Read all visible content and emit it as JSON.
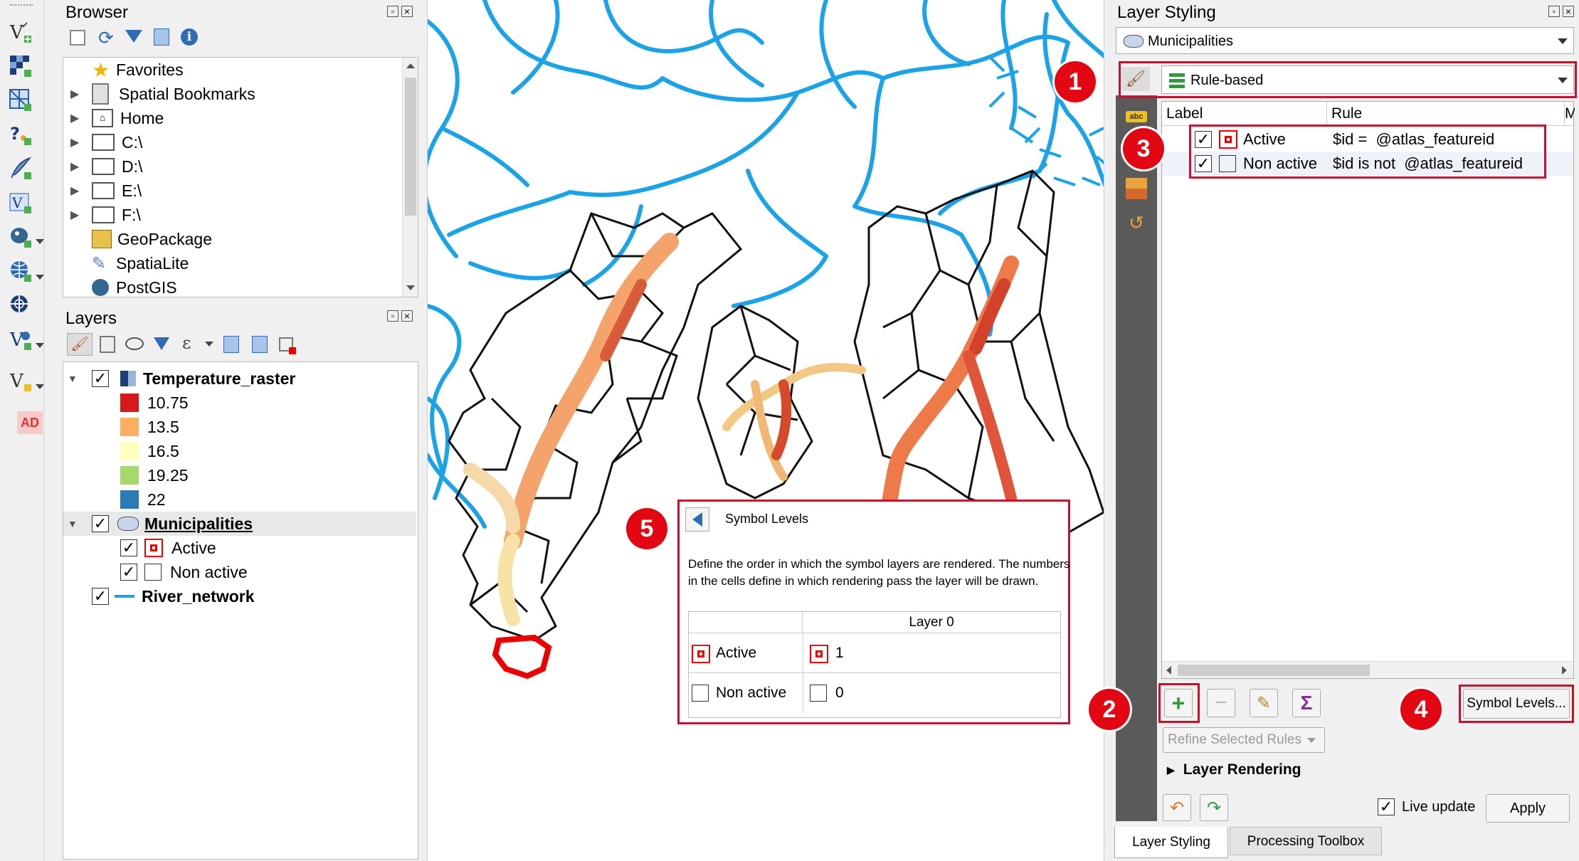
{
  "browser": {
    "title": "Browser",
    "items": [
      {
        "label": "Favorites",
        "icon": "star-icon"
      },
      {
        "label": "Spatial Bookmarks",
        "icon": "bookmark-icon"
      },
      {
        "label": "Home",
        "icon": "home-folder-icon"
      },
      {
        "label": "C:\\",
        "icon": "folder-icon"
      },
      {
        "label": "D:\\",
        "icon": "folder-icon"
      },
      {
        "label": "E:\\",
        "icon": "folder-icon"
      },
      {
        "label": "F:\\",
        "icon": "folder-icon"
      },
      {
        "label": "GeoPackage",
        "icon": "geopackage-icon"
      },
      {
        "label": "SpatiaLite",
        "icon": "feather-icon"
      },
      {
        "label": "PostGIS",
        "icon": "elephant-icon"
      }
    ]
  },
  "layers": {
    "title": "Layers",
    "temperature": {
      "name": "Temperature_raster",
      "classes": [
        {
          "value": "10.75",
          "color": "#d7191c"
        },
        {
          "value": "13.5",
          "color": "#fdae61"
        },
        {
          "value": "16.5",
          "color": "#ffffbf"
        },
        {
          "value": "19.25",
          "color": "#a6d96a"
        },
        {
          "value": "22",
          "color": "#2c7bb6"
        }
      ]
    },
    "municipalities": {
      "name": "Municipalities",
      "rules": [
        {
          "label": "Active"
        },
        {
          "label": "Non active"
        }
      ]
    },
    "river": {
      "name": "River_network",
      "color": "#1aa3e8"
    }
  },
  "left_toolbar": {
    "ad_label": "AD"
  },
  "symbol_levels_popup": {
    "title": "Symbol Levels",
    "description": "Define the order in which the symbol layers are rendered. The numbers in the cells define in which rendering pass the layer will be drawn.",
    "column_header": "Layer 0",
    "rows": [
      {
        "label": "Active",
        "pass": "1"
      },
      {
        "label": "Non active",
        "pass": "0"
      }
    ]
  },
  "layer_styling": {
    "title": "Layer Styling",
    "layer_select": "Municipalities",
    "renderer_select": "Rule-based",
    "sidebar_abc": "abc",
    "columns": {
      "label": "Label",
      "rule": "Rule",
      "extra": "M"
    },
    "rules": [
      {
        "label": "Active",
        "rule": "$id =  @atlas_featureid"
      },
      {
        "label": "Non active",
        "rule": "$id is not  @atlas_featureid"
      }
    ],
    "symbol_levels_button": "Symbol Levels...",
    "refine_button": "Refine Selected Rules",
    "layer_rendering": "Layer Rendering",
    "live_update": "Live update",
    "apply_button": "Apply",
    "tabs": [
      "Layer Styling",
      "Processing Toolbox"
    ]
  },
  "annotations": {
    "b1": "1",
    "b2": "2",
    "b3": "3",
    "b4": "4",
    "b5": "5"
  },
  "colors": {
    "accent_red": "#c8102e",
    "river_blue": "#1aa3e8",
    "sidebar_dark": "#5a5a5a"
  }
}
